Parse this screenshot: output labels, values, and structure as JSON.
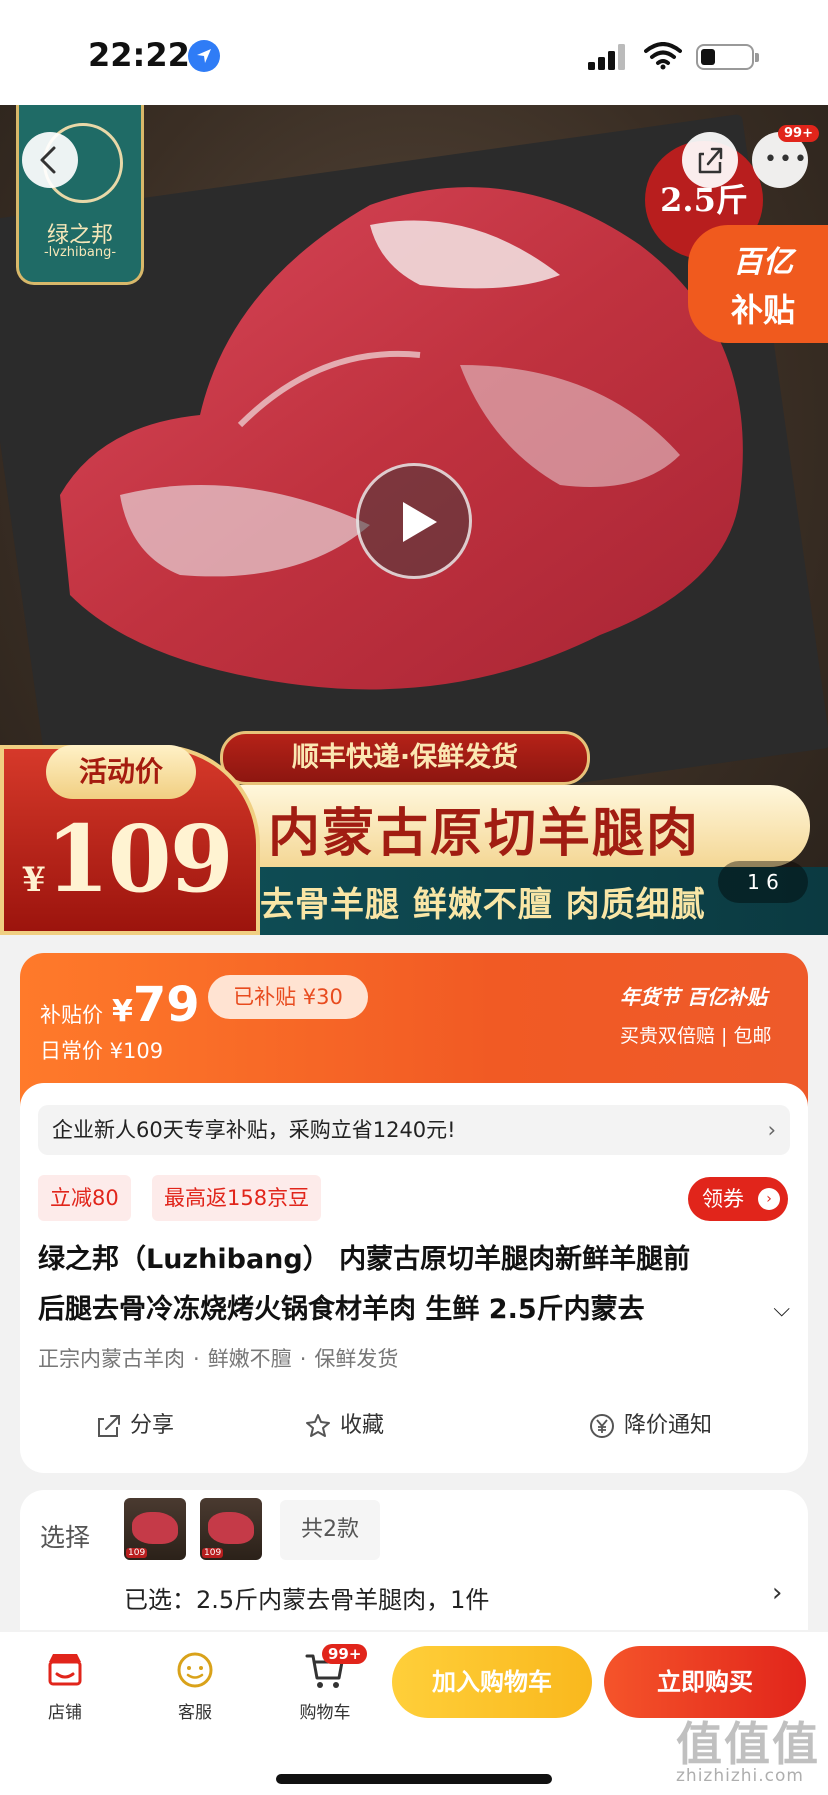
{
  "status_bar": {
    "time": "22:22"
  },
  "hero": {
    "brand_name": "绿之邦",
    "brand_sub": "-lvzhibang-",
    "weight_tag": "2.5斤",
    "subsidy_tag_line1": "百亿",
    "subsidy_tag_line2": "补贴",
    "more_badge": "99+",
    "promo_shipping": "顺丰快递·保鲜发货",
    "promo_title": "内蒙古原切羊腿肉",
    "promo_sub": "去骨羊腿 鲜嫩不膻 肉质细腻",
    "activity_label": "活动价",
    "activity_currency": "¥",
    "activity_price": "109",
    "page_indicator": "1 6"
  },
  "price": {
    "subsidy_label": "补贴价",
    "currency": "¥",
    "subsidy_price": "79",
    "saved_tag": "已补贴 ¥30",
    "daily_price": "日常价 ¥109",
    "right_badge": "年货节 百亿补贴",
    "right_sub": "买贵双倍赔 | 包邮"
  },
  "info": {
    "notice": "企业新人60天专享补贴，采购立省1240元!",
    "tag_discount": "立减80",
    "tag_beans": "最高返158京豆",
    "coupon_button": "领券",
    "title_line1": "绿之邦（Luzhibang） 内蒙古原切羊腿肉新鲜羊腿前",
    "title_line2": "后腿去骨冷冻烧烤火锅食材羊肉 生鲜 2.5斤内蒙去",
    "features": [
      "正宗内蒙古羊肉",
      "鲜嫩不膻",
      "保鲜发货"
    ],
    "action_share": "分享",
    "action_favorite": "收藏",
    "action_price_alert": "降价通知"
  },
  "select": {
    "label": "选择",
    "count_tag": "共2款",
    "selected": "已选：2.5斤内蒙去骨羊腿肉，1件"
  },
  "bottom_bar": {
    "store": "店铺",
    "service": "客服",
    "cart": "购物车",
    "cart_badge": "99+",
    "add_to_cart": "加入购物车",
    "buy_now": "立即购买"
  },
  "watermark": {
    "main": "值值值",
    "sub": "zhizhizhi.com"
  },
  "colors": {
    "accent_red": "#e1251b",
    "accent_orange": "#f15a24",
    "accent_yellow": "#f9b81d",
    "brand_teal": "#1f6b66"
  }
}
